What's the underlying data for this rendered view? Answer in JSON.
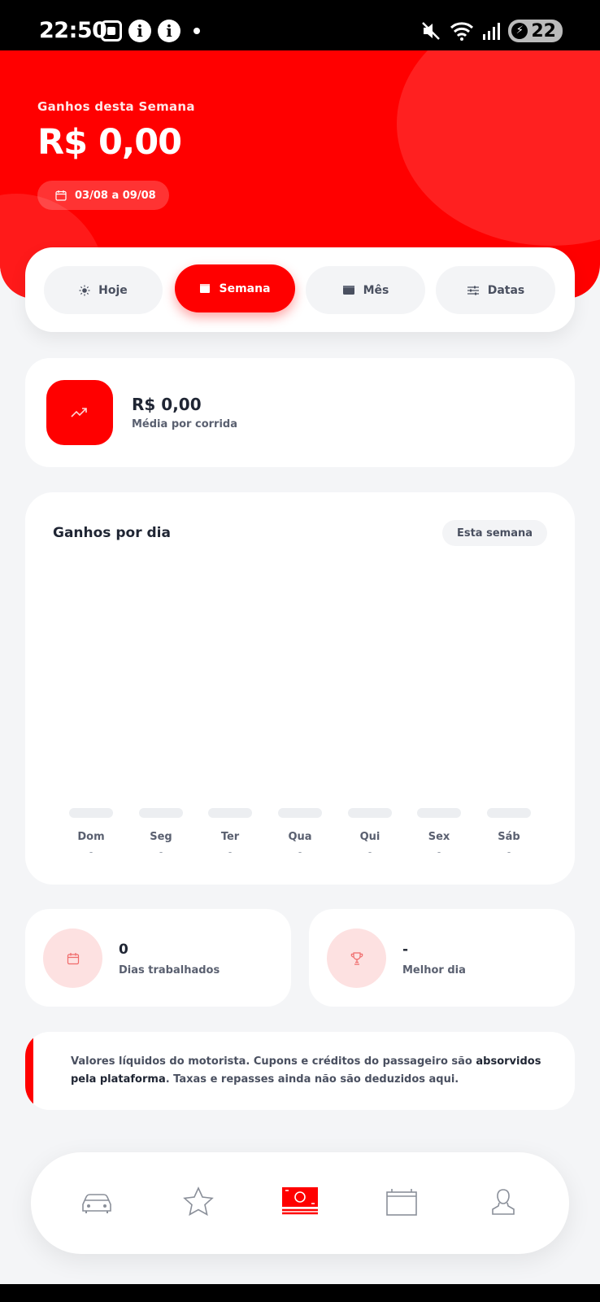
{
  "status_bar": {
    "time": "22:50",
    "battery": "22",
    "icons": [
      "screenshot-icon",
      "info-icon",
      "info-icon",
      "dot-icon",
      "mute-icon",
      "wifi-icon",
      "signal-icon",
      "battery-saver-icon"
    ]
  },
  "header": {
    "title": "Ganhos desta Semana",
    "amount": "R$ 0,00",
    "date_range": "03/08 a 09/08",
    "brand_color": "#ff0000"
  },
  "period_tabs": [
    {
      "label": "Hoje",
      "icon": "sun-icon",
      "active": false
    },
    {
      "label": "Semana",
      "icon": "calendar-week-icon",
      "active": true
    },
    {
      "label": "Mês",
      "icon": "calendar-month-icon",
      "active": false
    },
    {
      "label": "Datas",
      "icon": "sliders-icon",
      "active": false
    }
  ],
  "average": {
    "value": "R$ 0,00",
    "label": "Média por corrida",
    "icon": "trending-up-icon"
  },
  "chart": {
    "title": "Ganhos por dia",
    "filter_chip": "Esta semana",
    "days": [
      {
        "label": "Dom",
        "value": "-"
      },
      {
        "label": "Seg",
        "value": "-"
      },
      {
        "label": "Ter",
        "value": "-"
      },
      {
        "label": "Qua",
        "value": "-"
      },
      {
        "label": "Qui",
        "value": "-"
      },
      {
        "label": "Sex",
        "value": "-"
      },
      {
        "label": "Sáb",
        "value": "-"
      }
    ]
  },
  "stats": {
    "days_worked": {
      "value": "0",
      "label": "Dias trabalhados",
      "icon": "calendar-icon"
    },
    "best_day": {
      "value": "-",
      "label": "Melhor dia",
      "icon": "trophy-icon"
    }
  },
  "note": {
    "part1": "Valores líquidos do motorista. Cupons e créditos do passageiro são ",
    "bold": "absorvidos pela plataforma",
    "part2": ". Taxas e repasses ainda não são deduzidos aqui."
  },
  "bottom_nav": [
    {
      "name": "rides",
      "icon": "car-icon",
      "active": false
    },
    {
      "name": "ratings",
      "icon": "star-icon",
      "active": false
    },
    {
      "name": "earnings",
      "icon": "money-icon",
      "active": true
    },
    {
      "name": "wallet",
      "icon": "briefcase-icon",
      "active": false
    },
    {
      "name": "profile",
      "icon": "user-icon",
      "active": false
    }
  ]
}
